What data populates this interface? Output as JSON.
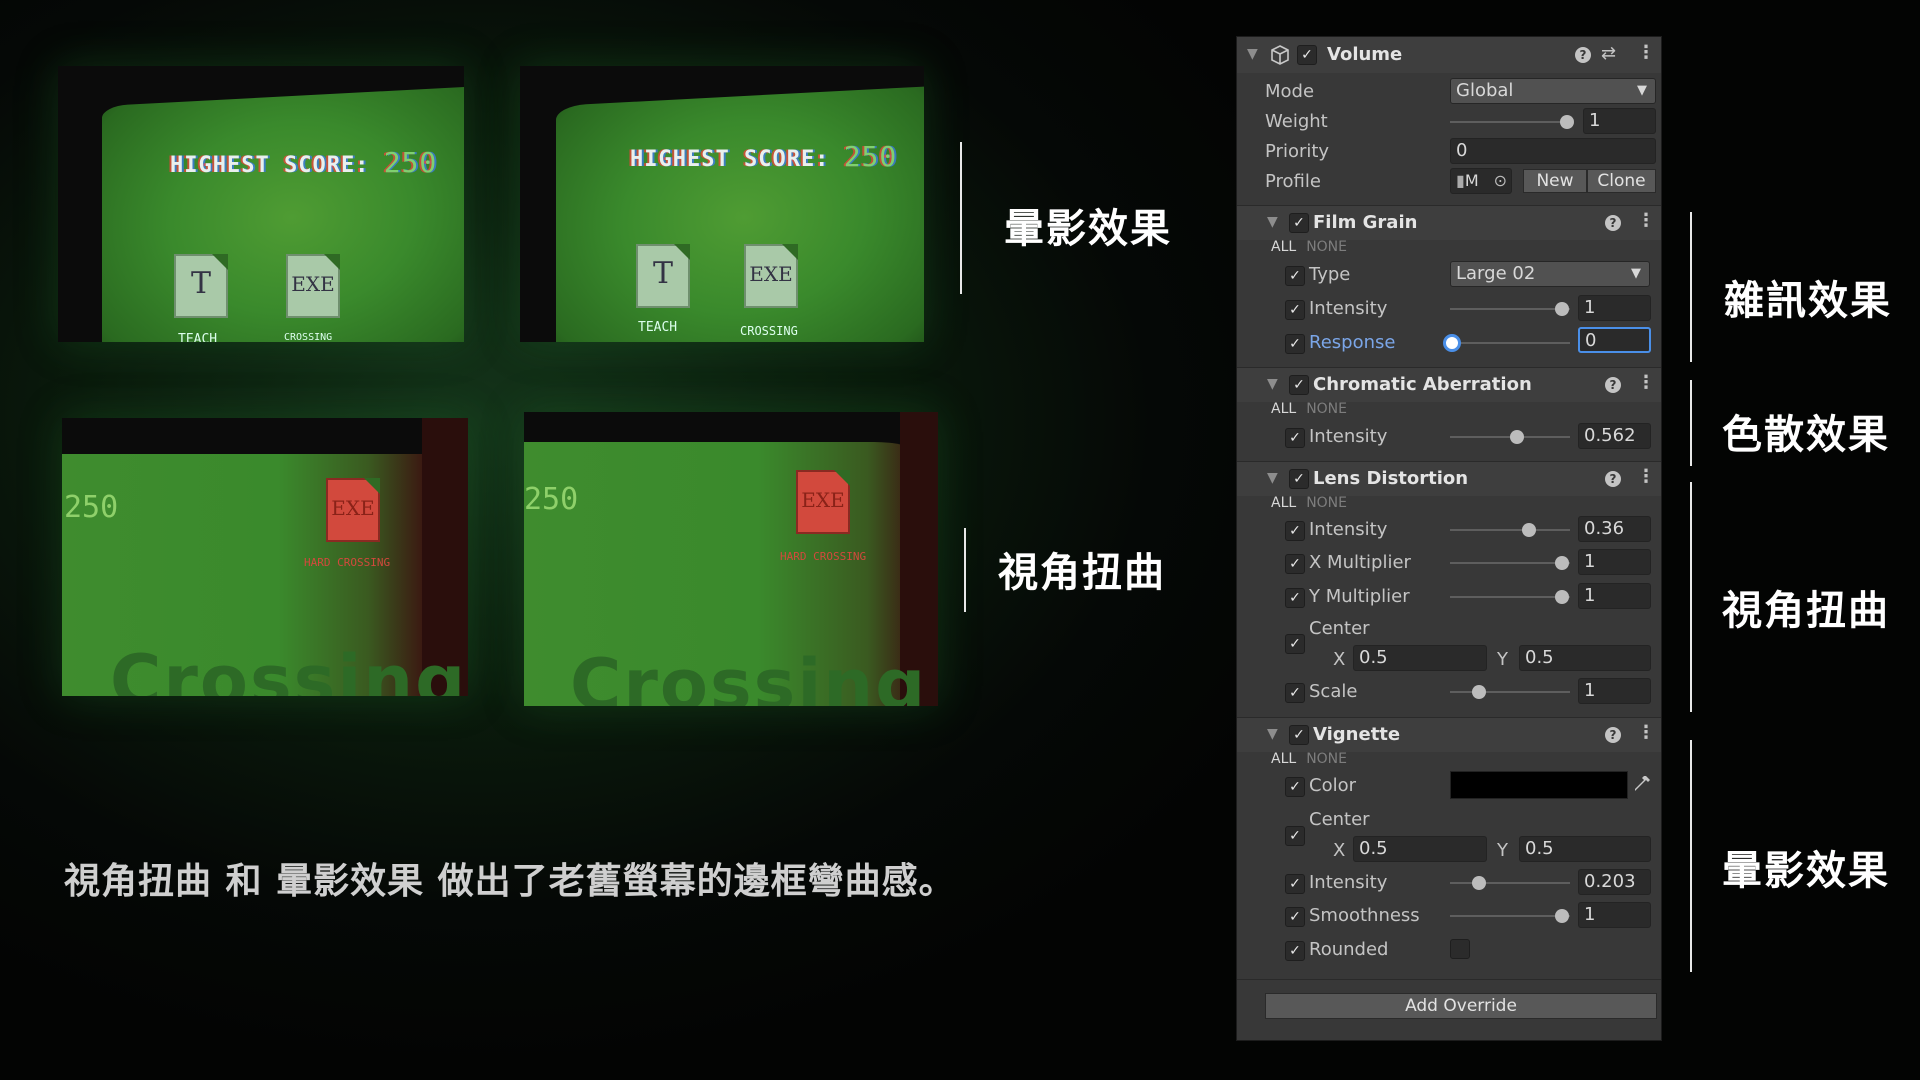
{
  "screens": {
    "highest_score_label": "HIGHEST SCORE:",
    "score": "250",
    "file_t": "T",
    "file_exe": "EXE",
    "teach": "TEACH",
    "crossing": "CROSSING",
    "hard_crossing": "HARD CROSSING",
    "big_word": "Crossing"
  },
  "left_labels": {
    "top": "暈影效果",
    "bottom": "視角扭曲"
  },
  "caption": "視角扭曲 和 暈影效果 做出了老舊螢幕的邊框彎曲感。",
  "right_labels": {
    "film_grain": "雜訊效果",
    "chromatic": "色散效果",
    "lens": "視角扭曲",
    "vignette": "暈影效果"
  },
  "inspector": {
    "component_title": "Volume",
    "mode_label": "Mode",
    "mode_value": "Global",
    "weight_label": "Weight",
    "weight_value": "1",
    "priority_label": "Priority",
    "priority_value": "0",
    "profile_label": "Profile",
    "profile_value": "M",
    "new_button": "New",
    "clone_button": "Clone",
    "all": "ALL",
    "none": "NONE",
    "film_grain": {
      "title": "Film Grain",
      "type_label": "Type",
      "type_value": "Large 02",
      "intensity_label": "Intensity",
      "intensity_value": "1",
      "response_label": "Response",
      "response_value": "0"
    },
    "chromatic": {
      "title": "Chromatic Aberration",
      "intensity_label": "Intensity",
      "intensity_value": "0.562"
    },
    "lens": {
      "title": "Lens Distortion",
      "intensity_label": "Intensity",
      "intensity_value": "0.36",
      "xmul_label": "X Multiplier",
      "xmul_value": "1",
      "ymul_label": "Y Multiplier",
      "ymul_value": "1",
      "center_label": "Center",
      "x_label": "X",
      "x_value": "0.5",
      "y_label": "Y",
      "y_value": "0.5",
      "scale_label": "Scale",
      "scale_value": "1"
    },
    "vignette": {
      "title": "Vignette",
      "color_label": "Color",
      "color_value": "#000000",
      "center_label": "Center",
      "x_label": "X",
      "x_value": "0.5",
      "y_label": "Y",
      "y_value": "0.5",
      "intensity_label": "Intensity",
      "intensity_value": "0.203",
      "smooth_label": "Smoothness",
      "smooth_value": "1",
      "rounded_label": "Rounded"
    },
    "add_override": "Add Override"
  }
}
